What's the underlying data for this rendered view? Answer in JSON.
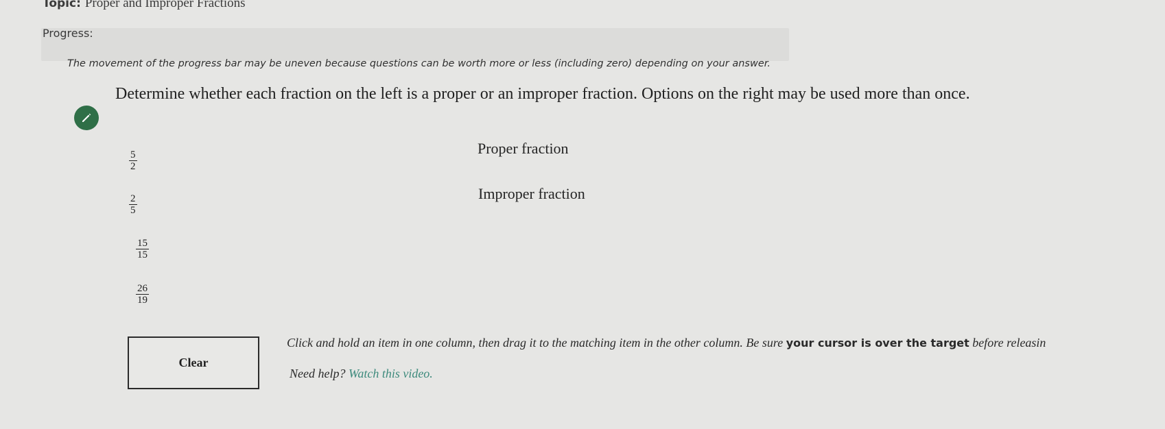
{
  "header": {
    "topic_label": "Topic:",
    "topic_text": "Proper and Improper Fractions"
  },
  "progress": {
    "label": "Progress:",
    "fraction": 0.0,
    "note": "The movement of the progress bar may be uneven because questions can be worth more or less (including zero) depending on your answer."
  },
  "question": {
    "icon": "pencil-icon",
    "prompt": "Determine whether each fraction on the left is a proper or an improper fraction. Options on the right may be used more than once."
  },
  "left_items": [
    {
      "numerator": "5",
      "denominator": "2"
    },
    {
      "numerator": "2",
      "denominator": "5"
    },
    {
      "numerator": "15",
      "denominator": "15"
    },
    {
      "numerator": "26",
      "denominator": "19"
    }
  ],
  "right_items": [
    {
      "label": "Proper fraction"
    },
    {
      "label": "Improper fraction"
    }
  ],
  "controls": {
    "clear_label": "Clear"
  },
  "instructions": {
    "text_start": "Click and hold an item in one column, then drag it to the matching item in the other column. Be sure ",
    "text_bold": "your cursor is over the target",
    "text_end": " before releasin",
    "help_prefix": "Need help?",
    "help_link": "Watch this video."
  },
  "colors": {
    "accent_green": "#2f6f47",
    "link_teal": "#3d8a7c"
  }
}
